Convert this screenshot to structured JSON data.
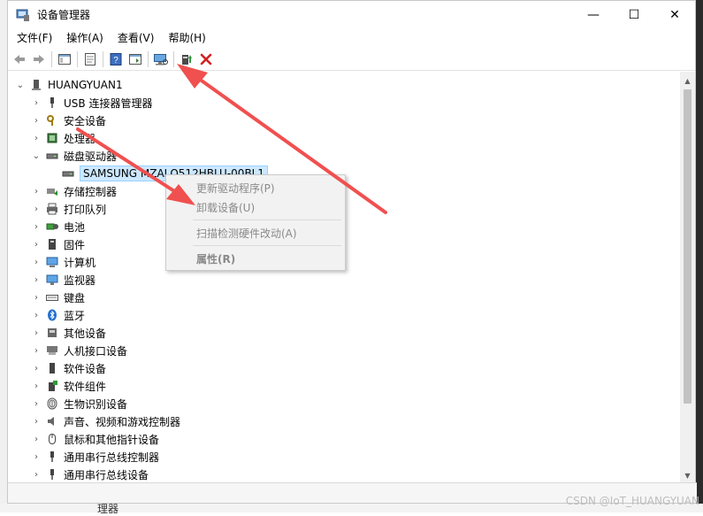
{
  "window": {
    "title": "设备管理器",
    "controls": {
      "minimize": "—",
      "maximize": "☐",
      "close": "✕"
    }
  },
  "menu": [
    "文件(F)",
    "操作(A)",
    "查看(V)",
    "帮助(H)"
  ],
  "toolbar": {
    "icons": [
      "back-arrow-icon",
      "forward-arrow-icon",
      "show-hide-tree-icon",
      "properties-icon",
      "help-icon",
      "view-icon",
      "scan-hardware-icon",
      "update-driver-icon",
      "uninstall-icon"
    ]
  },
  "tree": {
    "root": "HUANGYUAN1",
    "categories": [
      {
        "label": "USB 连接器管理器",
        "icon": "usb-icon",
        "expanded": false
      },
      {
        "label": "安全设备",
        "icon": "security-key-icon",
        "expanded": false
      },
      {
        "label": "处理器",
        "icon": "processor-icon",
        "expanded": false
      },
      {
        "label": "磁盘驱动器",
        "icon": "disk-drive-icon",
        "expanded": true
      },
      {
        "label": "存储控制器",
        "icon": "storage-controller-icon",
        "expanded": false
      },
      {
        "label": "打印队列",
        "icon": "printer-icon",
        "expanded": false
      },
      {
        "label": "电池",
        "icon": "battery-icon",
        "expanded": false
      },
      {
        "label": "固件",
        "icon": "firmware-icon",
        "expanded": false
      },
      {
        "label": "计算机",
        "icon": "computer-icon",
        "expanded": false
      },
      {
        "label": "监视器",
        "icon": "monitor-icon",
        "expanded": false
      },
      {
        "label": "键盘",
        "icon": "keyboard-icon",
        "expanded": false
      },
      {
        "label": "蓝牙",
        "icon": "bluetooth-icon",
        "expanded": false
      },
      {
        "label": "其他设备",
        "icon": "other-device-icon",
        "expanded": false
      },
      {
        "label": "人机接口设备",
        "icon": "hid-icon",
        "expanded": false
      },
      {
        "label": "软件设备",
        "icon": "software-device-icon",
        "expanded": false
      },
      {
        "label": "软件组件",
        "icon": "software-component-icon",
        "expanded": false
      },
      {
        "label": "生物识别设备",
        "icon": "fingerprint-icon",
        "expanded": false
      },
      {
        "label": "声音、视频和游戏控制器",
        "icon": "speaker-icon",
        "expanded": false
      },
      {
        "label": "鼠标和其他指针设备",
        "icon": "mouse-icon",
        "expanded": false
      },
      {
        "label": "通用串行总线控制器",
        "icon": "usb-controller-icon",
        "expanded": false
      },
      {
        "label": "通用串行总线设备",
        "icon": "usb-device-icon",
        "expanded": false
      }
    ],
    "disk_child": "SAMSUNG MZALQ512HBLU-00BL1"
  },
  "context_menu": {
    "items": [
      "更新驱动程序(P)",
      "卸载设备(U)",
      "扫描检测硬件改动(A)",
      "属性(R)"
    ]
  },
  "watermark": "CSDN @IoT_HUANGYUAN",
  "bottom_cut_text": "理器",
  "colors": {
    "selection": "#cce8ff",
    "annotation_arrow": "#f0504f",
    "disabled_text": "#8a8a8a"
  }
}
